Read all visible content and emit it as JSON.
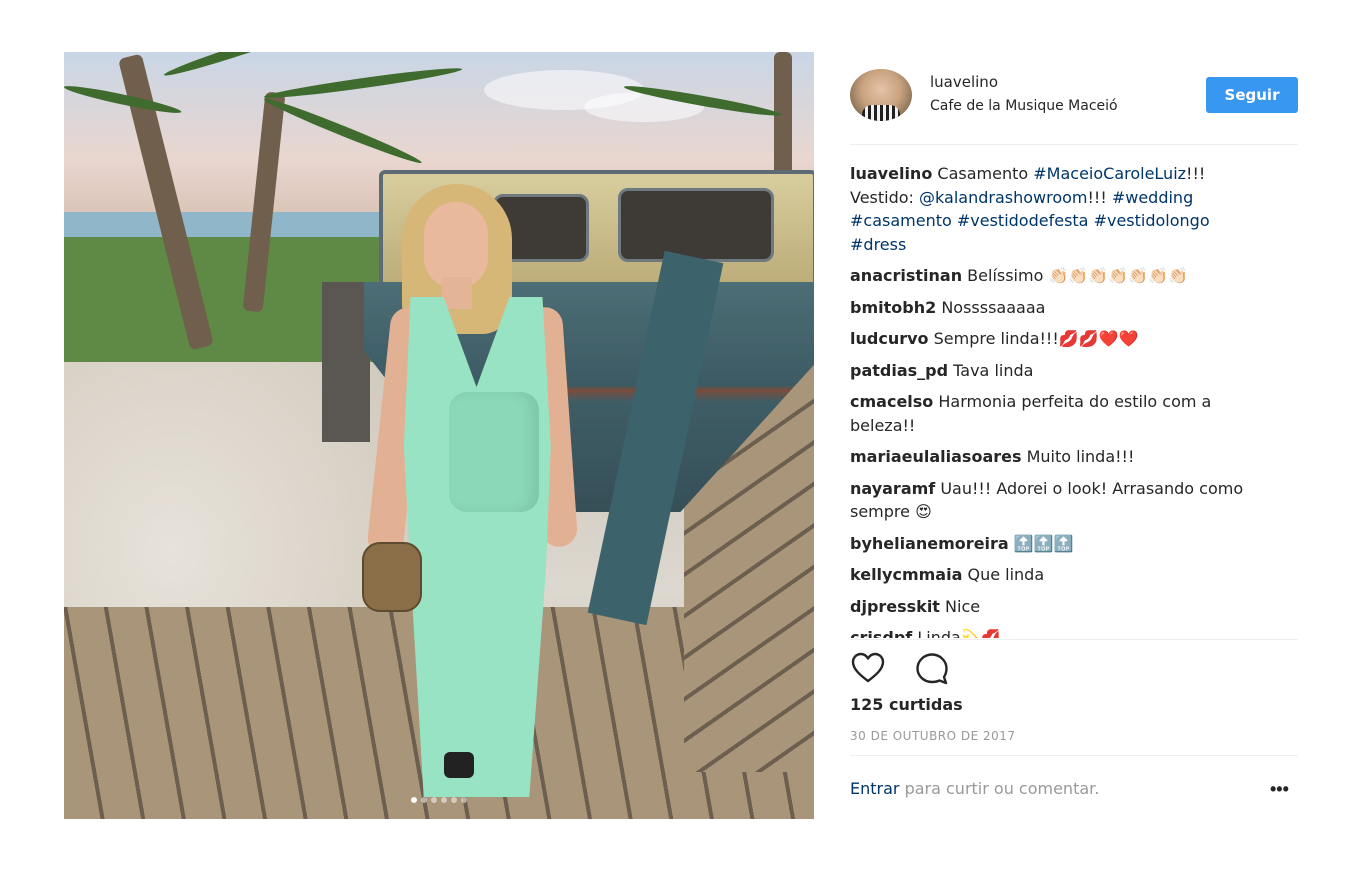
{
  "post": {
    "username": "luavelino",
    "location": "Cafe de la Musique Maceió",
    "follow_label": "Seguir",
    "caption": {
      "user": "luavelino",
      "parts": [
        {
          "t": "Casamento ",
          "tag": false
        },
        {
          "t": "#MaceioCaroleLuiz",
          "tag": true
        },
        {
          "t": "!!! Vestido: ",
          "tag": false
        },
        {
          "t": "@kalandrashowroom",
          "tag": true
        },
        {
          "t": "!!! ",
          "tag": false
        },
        {
          "t": "#wedding",
          "tag": true
        },
        {
          "t": " ",
          "tag": false
        },
        {
          "t": "#casamento",
          "tag": true
        },
        {
          "t": " ",
          "tag": false
        },
        {
          "t": "#vestidodefesta",
          "tag": true
        },
        {
          "t": " ",
          "tag": false
        },
        {
          "t": "#vestidolongo",
          "tag": true
        },
        {
          "t": " ",
          "tag": false
        },
        {
          "t": "#dress",
          "tag": true
        }
      ]
    },
    "comments": [
      {
        "user": "anacristinan",
        "text": "Belíssimo 👏🏻👏🏻👏🏻👏🏻👏🏻👏🏻👏🏻"
      },
      {
        "user": "bmitobh2",
        "text": "Nossssaaaaa"
      },
      {
        "user": "ludcurvo",
        "text": "Sempre linda!!!💋💋❤️❤️"
      },
      {
        "user": "patdias_pd",
        "text": "Tava linda"
      },
      {
        "user": "cmacelso",
        "text": "Harmonia perfeita do estilo com a beleza!!"
      },
      {
        "user": "mariaeulaliasoares",
        "text": "Muito linda!!!"
      },
      {
        "user": "nayaramf",
        "text": "Uau!!! Adorei o look! Arrasando como sempre 😍"
      },
      {
        "user": "byhelianemoreira",
        "text": "🔝🔝🔝"
      },
      {
        "user": "kellycmmaia",
        "text": "Que linda"
      },
      {
        "user": "djpresskit",
        "text": "Nice"
      },
      {
        "user": "crisdpf",
        "text": "Linda💫💋"
      }
    ],
    "likes": "125 curtidas",
    "date": "30 DE OUTUBRO DE 2017",
    "login_link": "Entrar",
    "login_rest": " para curtir ou comentar.",
    "more_label": "•••",
    "carousel": {
      "count": 6,
      "active_index": 0
    }
  },
  "colors": {
    "follow_button": "#3897f0",
    "hashtag": "#003569",
    "muted": "#999999",
    "text": "#262626"
  },
  "icons": [
    "heart-icon",
    "comment-icon",
    "more-options-icon"
  ]
}
